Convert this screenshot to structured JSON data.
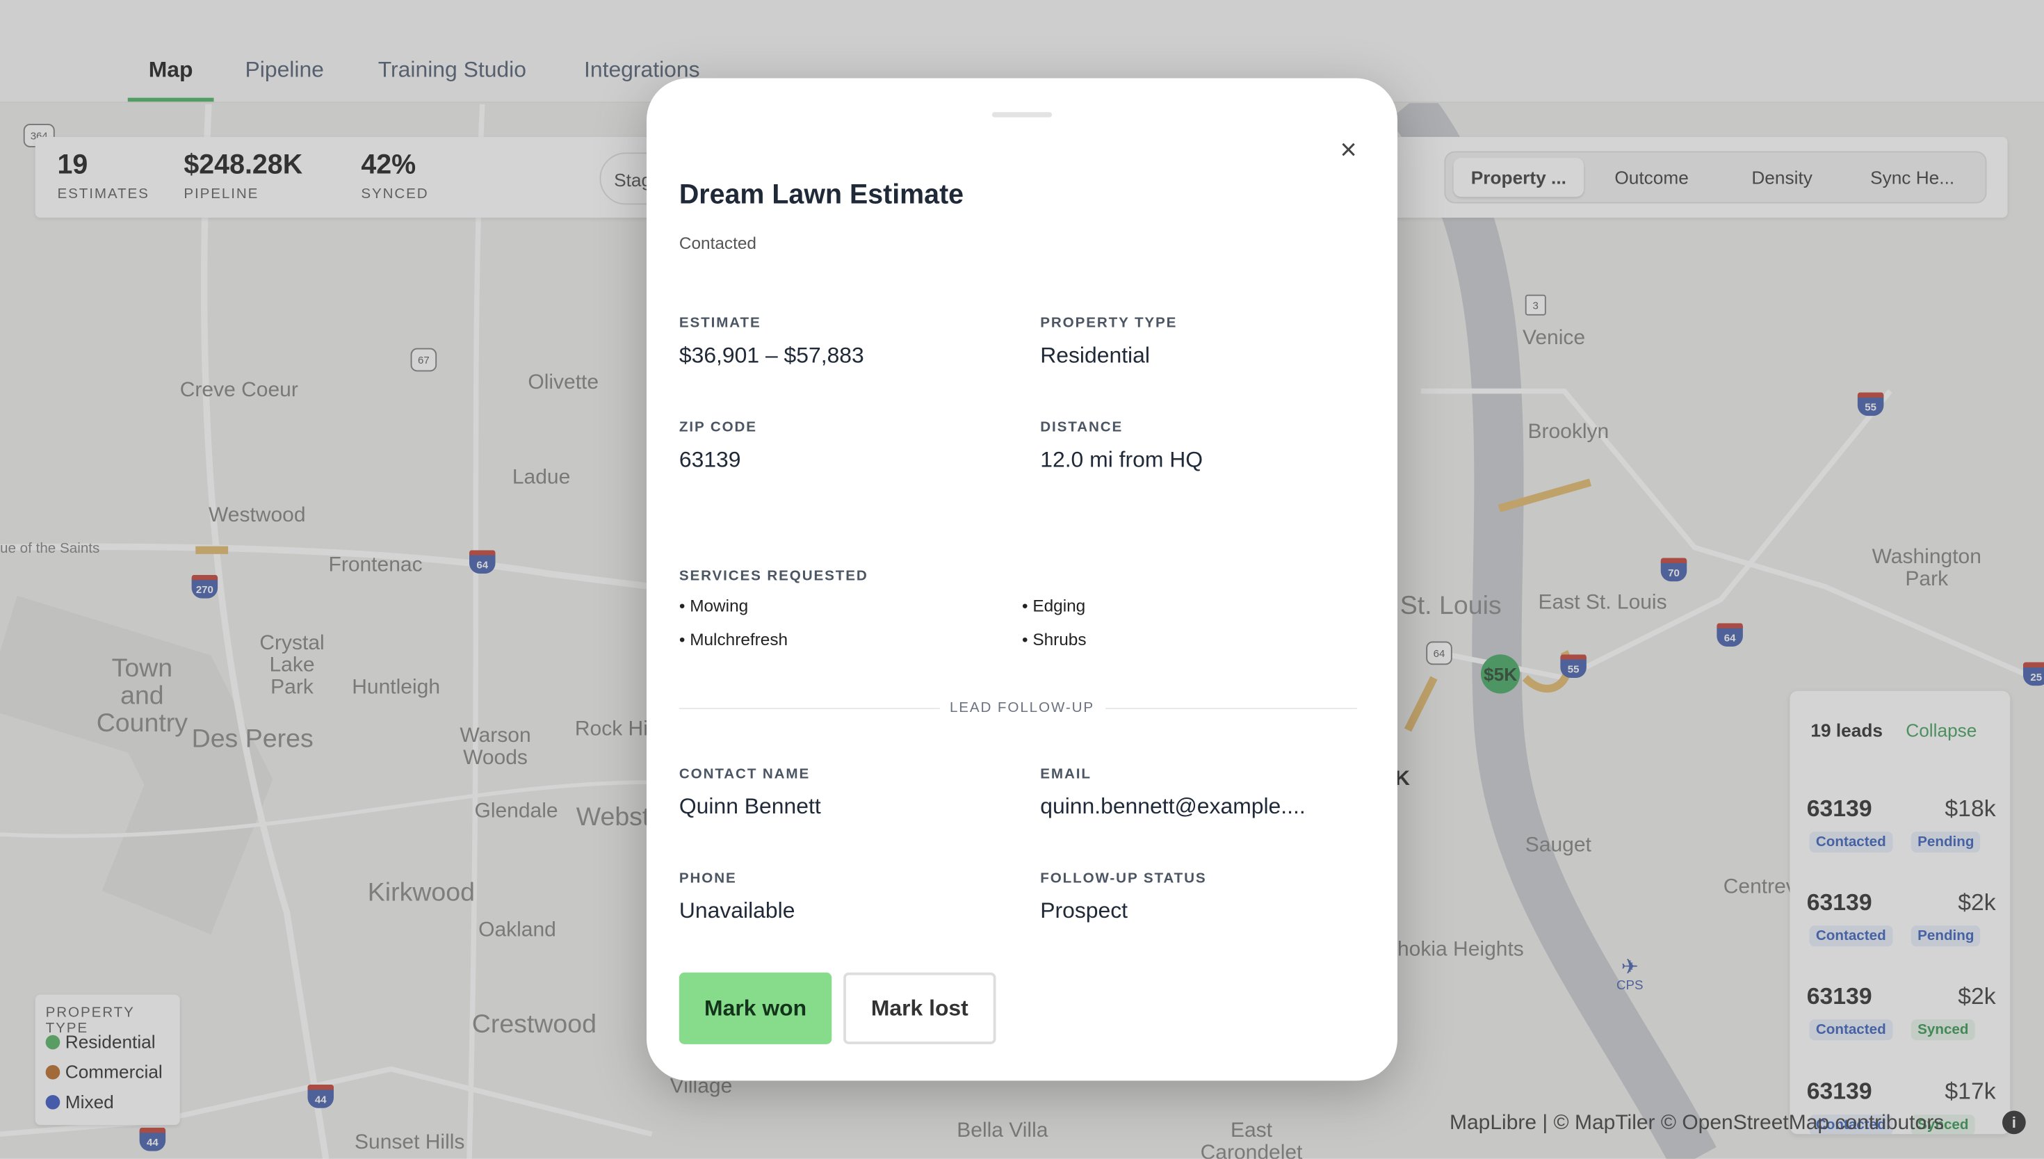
{
  "nav": {
    "tabs": [
      "Map",
      "Pipeline",
      "Training Studio",
      "Integrations"
    ]
  },
  "stats": [
    {
      "value": "19",
      "label": "ESTIMATES"
    },
    {
      "value": "$248.28K",
      "label": "PIPELINE"
    },
    {
      "value": "42%",
      "label": "SYNCED"
    }
  ],
  "stage_filter": "Stag",
  "map_modes": [
    "Property ...",
    "Outcome",
    "Density",
    "Sync He..."
  ],
  "map": {
    "places": [
      "Creve Coeur",
      "Olivette",
      "Ladue",
      "Westwood",
      "Frontenac",
      "Crystal Lake Park",
      "Town and Country",
      "Huntleigh",
      "Des Peres",
      "Warson Woods",
      "Rock Hi",
      "Webste",
      "Glendale",
      "Kirkwood",
      "Oakland",
      "Crestwood",
      "Sunset Hills",
      "Village",
      "Bella Villa",
      "East Carondelet",
      "Venice",
      "Brooklyn",
      "St. Louis",
      "East St. Louis",
      "Washington Park",
      "Sauget",
      "Centrev",
      "hokia Heights",
      "ue of the Saints"
    ],
    "highway_labels": [
      "364",
      "67",
      "270",
      "64",
      "64",
      "55",
      "70",
      "64",
      "55",
      "44",
      "44",
      "3",
      "25"
    ],
    "marker": "$5K",
    "marker_k": "K",
    "cps": "CPS"
  },
  "legend": {
    "title": "PROPERTY TYPE",
    "items": [
      {
        "label": "Residential",
        "color": "#4caf5a"
      },
      {
        "label": "Commercial",
        "color": "#b5621e"
      },
      {
        "label": "Mixed",
        "color": "#2f4fc0"
      }
    ]
  },
  "leads": {
    "count": "19 leads",
    "collapse": "Collapse",
    "items": [
      {
        "zip": "63139",
        "amount": "$18k",
        "status": "Contacted",
        "sync": "Pending"
      },
      {
        "zip": "63139",
        "amount": "$2k",
        "status": "Contacted",
        "sync": "Pending"
      },
      {
        "zip": "63139",
        "amount": "$2k",
        "status": "Contacted",
        "sync": "Synced"
      },
      {
        "zip": "63139",
        "amount": "$17k",
        "status": "Contacted",
        "sync": "Synced"
      }
    ]
  },
  "attribution": "MapLibre | © MapTiler © OpenStreetMap contributors",
  "modal": {
    "title": "Dream Lawn Estimate",
    "status": "Contacted",
    "close": "×",
    "fields": {
      "estimate_label": "ESTIMATE",
      "estimate": "$36,901 – $57,883",
      "property_type_label": "PROPERTY TYPE",
      "property_type": "Residential",
      "zip_label": "ZIP CODE",
      "zip": "63139",
      "distance_label": "DISTANCE",
      "distance": "12.0 mi from HQ"
    },
    "services_label": "SERVICES REQUESTED",
    "services": [
      "Mowing",
      "Edging",
      "Mulchrefresh",
      "Shrubs"
    ],
    "followup_label": "LEAD FOLLOW-UP",
    "contact": {
      "name_label": "CONTACT NAME",
      "name": "Quinn Bennett",
      "email_label": "EMAIL",
      "email": "quinn.bennett@example....",
      "phone_label": "PHONE",
      "phone": "Unavailable",
      "followup_status_label": "FOLLOW-UP STATUS",
      "followup_status": "Prospect"
    },
    "btn_won": "Mark won",
    "btn_lost": "Mark lost"
  }
}
